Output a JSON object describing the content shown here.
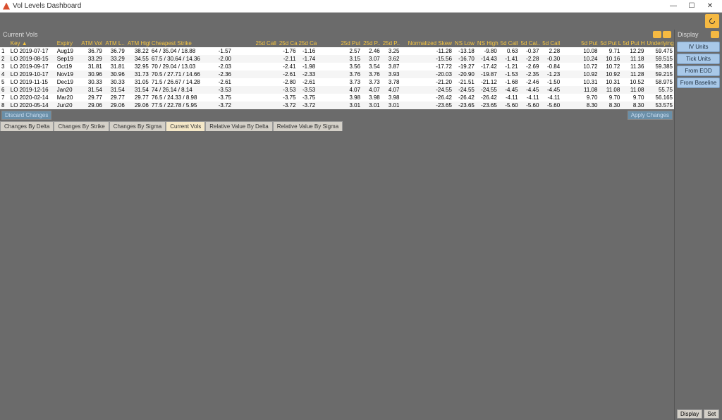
{
  "window": {
    "title": "Vol Levels Dashboard"
  },
  "leftPanel": {
    "title": "Current Vols"
  },
  "rightPanel": {
    "title": "Display"
  },
  "headers": [
    "",
    "Key ▲",
    "Expiry",
    "ATM Vol",
    "ATM L..",
    "ATM High",
    "Cheapest Strike",
    "",
    "25d Call",
    "25d Ca..",
    "25d Ca..",
    "25d Put",
    "25d P..",
    "25d P..",
    "Normalized Skew",
    "NS Low",
    "NS High",
    "5d Call",
    "5d Cal..",
    "5d Call",
    "5d Put",
    "5d Put L..",
    "5d Put H..",
    "Underlying"
  ],
  "rows": [
    [
      "1",
      "LO 2019-07-17",
      "Aug19",
      "36.79",
      "36.79",
      "38.22",
      "64 / 35.04 / 18.88",
      "-1.57",
      "-1.76",
      "-1.16",
      "2.57",
      "2.46",
      "3.25",
      "-11.28",
      "-13.18",
      "-9.80",
      "0.63",
      "-0.37",
      "2.28",
      "10.08",
      "9.71",
      "12.29",
      "59.475"
    ],
    [
      "2",
      "LO 2019-08-15",
      "Sep19",
      "33.29",
      "33.29",
      "34.55",
      "67.5 / 30.64 / 14.36",
      "-2.00",
      "-2.11",
      "-1.74",
      "3.15",
      "3.07",
      "3.62",
      "-15.56",
      "-16.70",
      "-14.43",
      "-1.41",
      "-2.28",
      "-0.30",
      "10.24",
      "10.16",
      "11.18",
      "59.515"
    ],
    [
      "3",
      "LO 2019-09-17",
      "Oct19",
      "31.81",
      "31.81",
      "32.95",
      "70 / 29.04 / 13.03",
      "-2.03",
      "-2.41",
      "-1.98",
      "3.56",
      "3.54",
      "3.87",
      "-17.72",
      "-19.27",
      "-17.42",
      "-1.21",
      "-2.69",
      "-0.84",
      "10.72",
      "10.72",
      "11.36",
      "59.385"
    ],
    [
      "4",
      "LO 2019-10-17",
      "Nov19",
      "30.96",
      "30.96",
      "31.73",
      "70.5 / 27.71 / 14.66",
      "-2.36",
      "-2.61",
      "-2.33",
      "3.76",
      "3.76",
      "3.93",
      "-20.03",
      "-20.90",
      "-19.87",
      "-1.53",
      "-2.35",
      "-1.23",
      "10.92",
      "10.92",
      "11.28",
      "59.215"
    ],
    [
      "5",
      "LO 2019-11-15",
      "Dec19",
      "30.33",
      "30.33",
      "31.05",
      "71.5 / 26.67 / 14.28",
      "-2.61",
      "-2.80",
      "-2.61",
      "3.73",
      "3.73",
      "3.78",
      "-21.20",
      "-21.51",
      "-21.12",
      "-1.68",
      "-2.46",
      "-1.50",
      "10.31",
      "10.31",
      "10.52",
      "58.975"
    ],
    [
      "6",
      "LO 2019-12-16",
      "Jan20",
      "31.54",
      "31.54",
      "31.54",
      "74 / 26.14 / 8.14",
      "-3.53",
      "-3.53",
      "-3.53",
      "4.07",
      "4.07",
      "4.07",
      "-24.55",
      "-24.55",
      "-24.55",
      "-4.45",
      "-4.45",
      "-4.45",
      "11.08",
      "11.08",
      "11.08",
      "55.75"
    ],
    [
      "7",
      "LO 2020-02-14",
      "Mar20",
      "29.77",
      "29.77",
      "29.77",
      "76.5 / 24.33 / 8.98",
      "-3.75",
      "-3.75",
      "-3.75",
      "3.98",
      "3.98",
      "3.98",
      "-26.42",
      "-26.42",
      "-26.42",
      "-4.11",
      "-4.11",
      "-4.11",
      "9.70",
      "9.70",
      "9.70",
      "56.165"
    ],
    [
      "8",
      "LO 2020-05-14",
      "Jun20",
      "29.06",
      "29.06",
      "29.06",
      "77.5 / 22.78 / 5.95",
      "-3.72",
      "-3.72",
      "-3.72",
      "3.01",
      "3.01",
      "3.01",
      "-23.65",
      "-23.65",
      "-23.65",
      "-5.60",
      "-5.60",
      "-5.60",
      "8.30",
      "8.30",
      "8.30",
      "53.575"
    ]
  ],
  "actions": {
    "discard": "Discard Changes",
    "apply": "Apply Changes"
  },
  "tabs": [
    "Changes By Delta",
    "Changes By Strike",
    "Changes By Sigma",
    "Current Vols",
    "Relative Value By Delta",
    "Relative Value By Sigma"
  ],
  "activeTab": 3,
  "sideButtons": [
    "IV Units",
    "Tick Units",
    "From EOD",
    "From Baseline"
  ],
  "bottomRight": [
    "Display",
    "Set"
  ]
}
